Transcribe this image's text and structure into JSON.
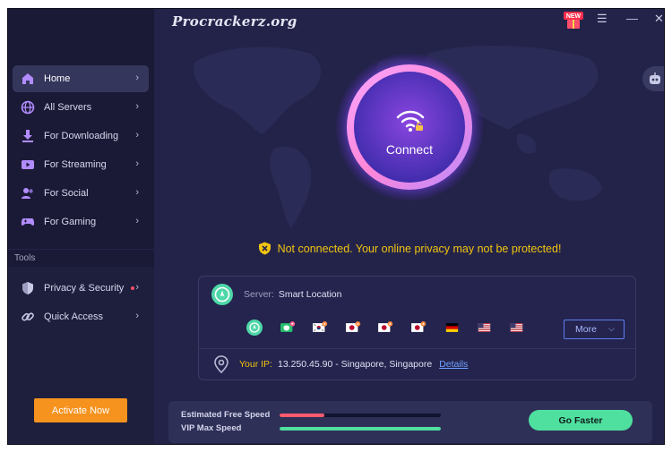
{
  "watermark": "Procrackerz.org",
  "window": {
    "new_badge": "NEW"
  },
  "sidebar": {
    "items": [
      {
        "label": "Home",
        "icon": "home-icon"
      },
      {
        "label": "All Servers",
        "icon": "globe-icon"
      },
      {
        "label": "For Downloading",
        "icon": "download-icon"
      },
      {
        "label": "For Streaming",
        "icon": "play-icon"
      },
      {
        "label": "For Social",
        "icon": "people-icon"
      },
      {
        "label": "For Gaming",
        "icon": "gamepad-icon"
      }
    ],
    "tools_label": "Tools",
    "tools": [
      {
        "label": "Privacy & Security",
        "icon": "shield-icon"
      },
      {
        "label": "Quick Access",
        "icon": "link-icon"
      }
    ],
    "activate_label": "Activate Now"
  },
  "connect": {
    "label": "Connect"
  },
  "status": {
    "text": "Not connected. Your online privacy may not be protected!"
  },
  "server": {
    "label": "Server:",
    "value": "Smart Location",
    "flags": [
      "smart-location",
      "streaming-green",
      "south-korea",
      "japan",
      "japan",
      "japan",
      "germany",
      "united-states",
      "united-states"
    ],
    "more_label": "More"
  },
  "ip": {
    "label": "Your IP:",
    "value": "13.250.45.90 - Singapore, Singapore",
    "details_label": "Details"
  },
  "speed": {
    "free_label": "Estimated Free Speed",
    "vip_label": "VIP Max Speed",
    "free_level": 0.28,
    "vip_level": 1.0,
    "go_label": "Go Faster"
  },
  "colors": {
    "accent": "#f6921e",
    "warning": "#f1c40f",
    "go": "#4fe0a0",
    "free_bar": "#ff5a6e",
    "vip_bar": "#4fe0a0"
  }
}
